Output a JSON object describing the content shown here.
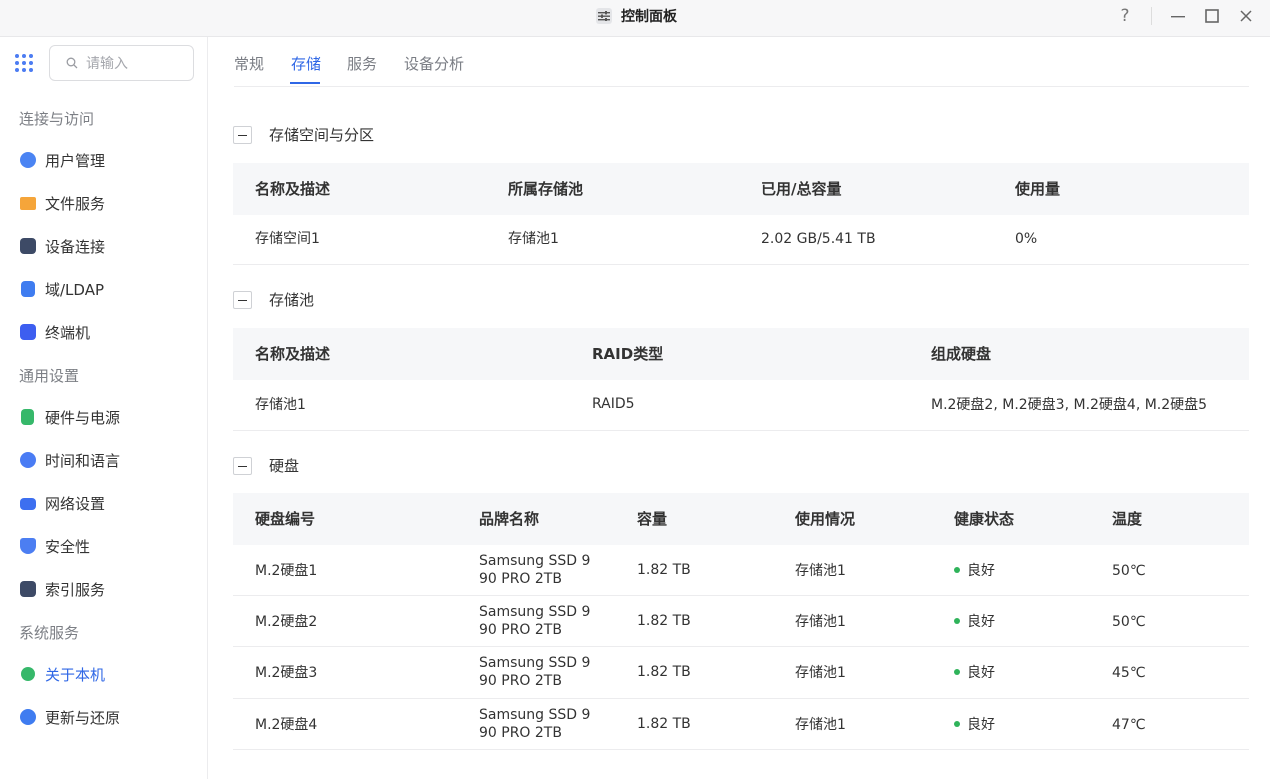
{
  "window": {
    "title": "控制面板",
    "help_label": "?",
    "minimize_label": "—",
    "maximize_label": "☐",
    "close_label": "✕"
  },
  "search": {
    "placeholder": "请输入"
  },
  "sidebar": {
    "groups": [
      {
        "title": "连接与访问",
        "items": [
          {
            "label": "用户管理",
            "icon": "user-icon",
            "color": "#4b84f3"
          },
          {
            "label": "文件服务",
            "icon": "folder-icon",
            "color": "#f5a53a"
          },
          {
            "label": "设备连接",
            "icon": "device-icon",
            "color": "#3d4a66"
          },
          {
            "label": "域/LDAP",
            "icon": "domain-icon",
            "color": "#3f7cf0"
          },
          {
            "label": "终端机",
            "icon": "terminal-icon",
            "color": "#3d5ef0"
          }
        ]
      },
      {
        "title": "通用设置",
        "items": [
          {
            "label": "硬件与电源",
            "icon": "hardware-icon",
            "color": "#36b86a"
          },
          {
            "label": "时间和语言",
            "icon": "globe-icon",
            "color": "#4a7cf4"
          },
          {
            "label": "网络设置",
            "icon": "network-icon",
            "color": "#3d6ff0"
          },
          {
            "label": "安全性",
            "icon": "shield-icon",
            "color": "#4c7ef2"
          },
          {
            "label": "索引服务",
            "icon": "index-icon",
            "color": "#3d4a66"
          }
        ]
      },
      {
        "title": "系统服务",
        "items": [
          {
            "label": "关于本机",
            "icon": "info-icon",
            "color": "#36b86a",
            "active": true
          },
          {
            "label": "更新与还原",
            "icon": "update-icon",
            "color": "#3f7cf0"
          }
        ]
      }
    ]
  },
  "tabs": [
    {
      "label": "常规"
    },
    {
      "label": "存储",
      "active": true
    },
    {
      "label": "服务"
    },
    {
      "label": "设备分析"
    }
  ],
  "volumes": {
    "title": "存储空间与分区",
    "headers": [
      "名称及描述",
      "所属存储池",
      "已用/总容量",
      "使用量"
    ],
    "rows": [
      [
        "存储空间1",
        "存储池1",
        "2.02 GB/5.41 TB",
        "0%"
      ]
    ]
  },
  "pools": {
    "title": "存储池",
    "headers": [
      "名称及描述",
      "RAID类型",
      "组成硬盘"
    ],
    "rows": [
      [
        "存储池1",
        "RAID5",
        "M.2硬盘2, M.2硬盘3, M.2硬盘4, M.2硬盘5"
      ]
    ]
  },
  "disks": {
    "title": "硬盘",
    "headers": [
      "硬盘编号",
      "品牌名称",
      "容量",
      "使用情况",
      "健康状态",
      "温度"
    ],
    "health_color": "#2fb35a",
    "rows": [
      {
        "id": "M.2硬盘1",
        "brand_line1": "Samsung SSD 9",
        "brand_line2": "90 PRO 2TB",
        "capacity": "1.82 TB",
        "usage": "存储池1",
        "health": "良好",
        "temp": "50℃"
      },
      {
        "id": "M.2硬盘2",
        "brand_line1": "Samsung SSD 9",
        "brand_line2": "90 PRO 2TB",
        "capacity": "1.82 TB",
        "usage": "存储池1",
        "health": "良好",
        "temp": "50℃"
      },
      {
        "id": "M.2硬盘3",
        "brand_line1": "Samsung SSD 9",
        "brand_line2": "90 PRO 2TB",
        "capacity": "1.82 TB",
        "usage": "存储池1",
        "health": "良好",
        "temp": "45℃"
      },
      {
        "id": "M.2硬盘4",
        "brand_line1": "Samsung SSD 9",
        "brand_line2": "90 PRO 2TB",
        "capacity": "1.82 TB",
        "usage": "存储池1",
        "health": "良好",
        "temp": "47℃"
      }
    ]
  }
}
